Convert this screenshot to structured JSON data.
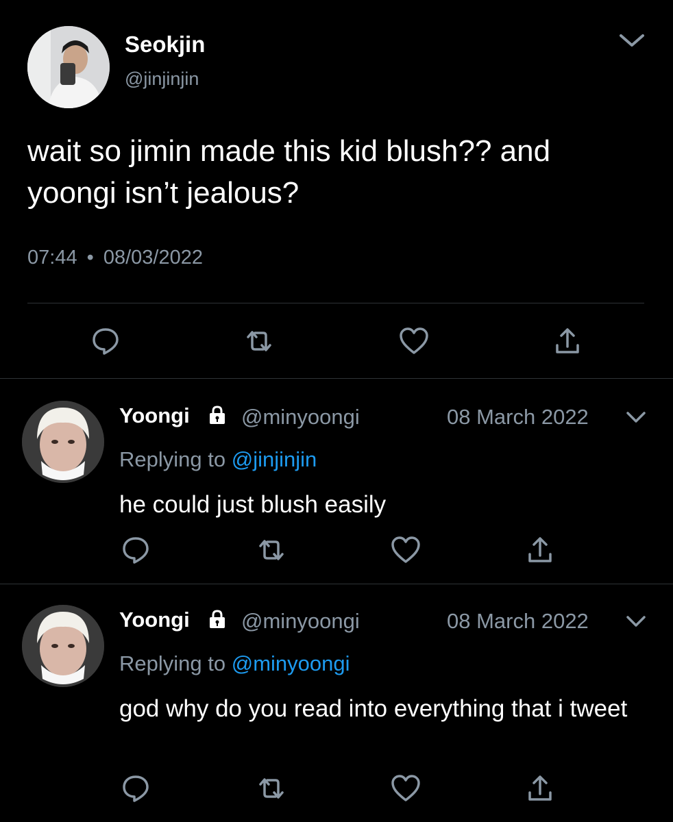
{
  "main_tweet": {
    "author_name": "Seokjin",
    "author_handle": "@jinjinjin",
    "text": "wait so jimin made this kid blush?? and yoongi isn’t jealous?",
    "time": "07:44",
    "separator": "•",
    "date": "08/03/2022",
    "actions": [
      "reply-icon",
      "retweet-icon",
      "like-icon",
      "share-icon"
    ]
  },
  "replies": [
    {
      "author_name": "Yoongi",
      "author_handle": "@minyoongi",
      "date": "08 March 2022",
      "replying_prefix": "Replying to",
      "replying_to": "@jinjinjin",
      "text": "he could just blush easily"
    },
    {
      "author_name": "Yoongi",
      "author_handle": "@minyoongi",
      "date": "08 March 2022",
      "replying_prefix": "Replying to",
      "replying_to": "@minyoongi",
      "text": "god why do you read into everything that i tweet"
    }
  ],
  "colors": {
    "background": "#000000",
    "secondary_text": "#8b98a5",
    "link": "#1d9bf0",
    "divider": "#2f3336"
  }
}
